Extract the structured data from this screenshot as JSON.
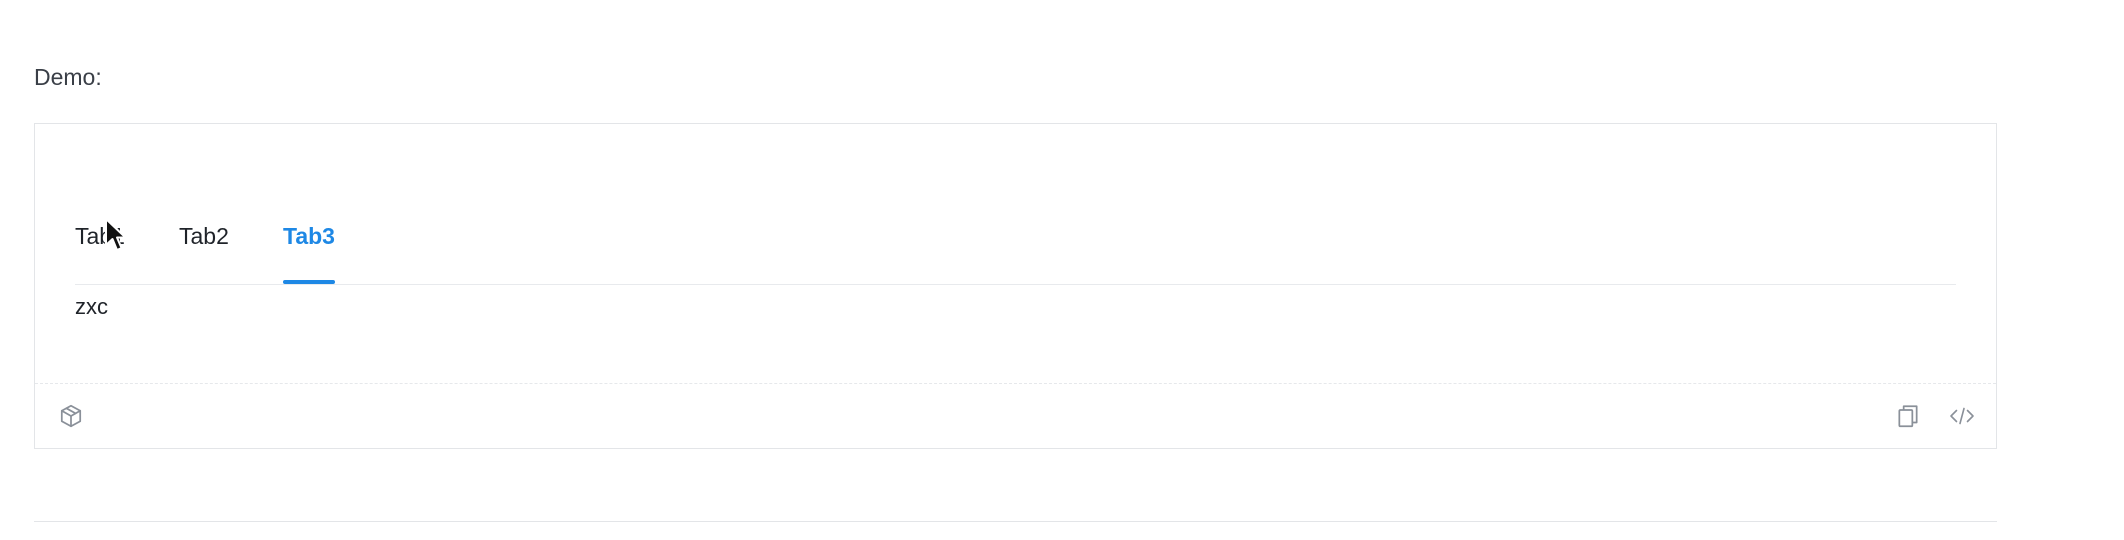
{
  "demo": {
    "label": "Demo:"
  },
  "tabs": {
    "items": [
      {
        "label": "Tab1",
        "active": false
      },
      {
        "label": "Tab2",
        "active": false
      },
      {
        "label": "Tab3",
        "active": true
      }
    ],
    "content": "zxc"
  },
  "footer": {
    "left_icon": "codesandbox-icon",
    "right_icons": [
      "copy-icon",
      "code-icon"
    ]
  },
  "colors": {
    "accent": "#1e88e5",
    "border": "#e3e5e8",
    "text": "#1f2329",
    "icon": "#8a9099"
  }
}
